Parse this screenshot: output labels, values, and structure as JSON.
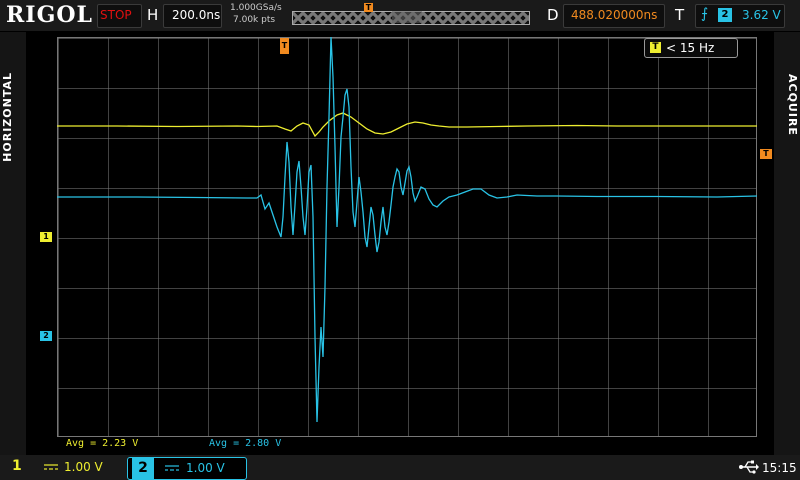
{
  "brand": "RIGOL",
  "run_state": "STOP",
  "horizontal": {
    "label": "H",
    "timebase": "200.0ns",
    "sample_rate": "1.000GSa/s",
    "points": "7.00k pts"
  },
  "delay": {
    "label": "D",
    "value": "488.020000ns"
  },
  "trigger": {
    "label": "T",
    "edge": "rising-edge-icon",
    "source": "2",
    "level": "3.62 V",
    "marker": "T"
  },
  "side": {
    "left": "HORIZONTAL",
    "right": "ACQUIRE"
  },
  "frequency": {
    "badge": "T",
    "value": "< 15 Hz"
  },
  "measure": {
    "ch1_avg": "Avg = 2.23 V",
    "ch2_avg": "Avg = 2.80 V"
  },
  "channels": [
    {
      "num": "1",
      "scale": "1.00 V",
      "coupling": "DC",
      "color": "#eeee30"
    },
    {
      "num": "2",
      "scale": "1.00 V",
      "coupling": "DC",
      "color": "#29c3e6"
    }
  ],
  "status": {
    "usb": "usb-icon",
    "time": "15:15"
  },
  "colors": {
    "ch1": "#eeee30",
    "ch2": "#29c3e6",
    "trigger": "#f18a1f",
    "stop": "#e01010"
  }
}
